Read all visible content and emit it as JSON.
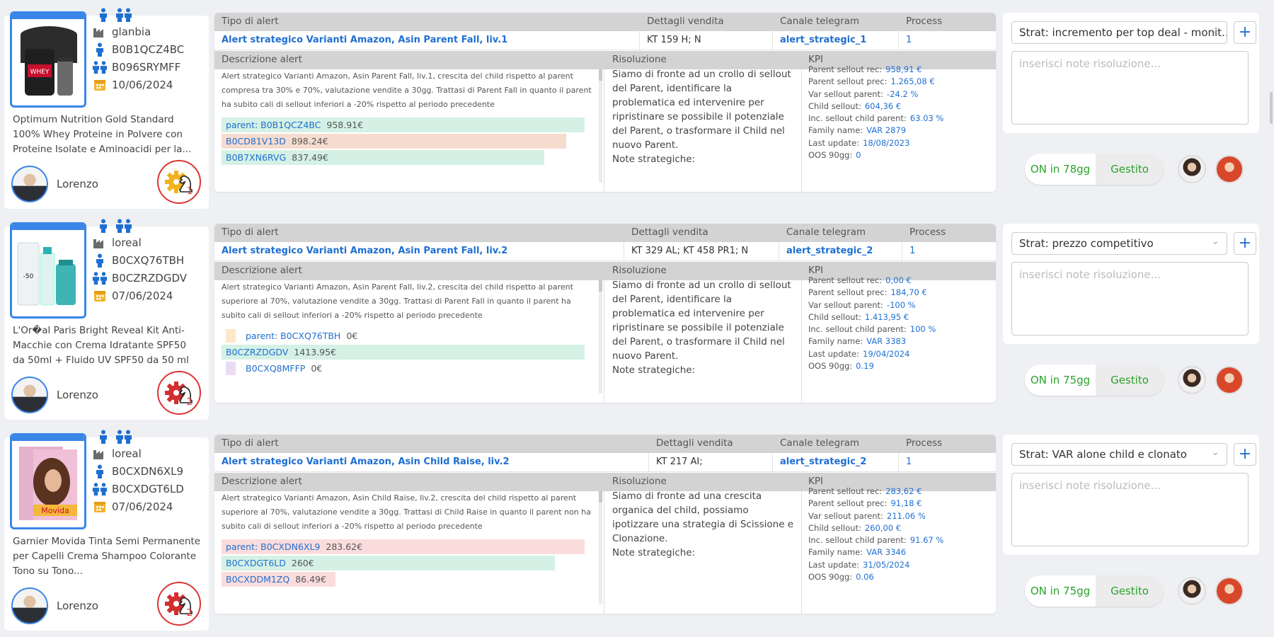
{
  "rows": [
    {
      "brand": "glanbia",
      "asin_child": "B0B1QCZ4BC",
      "asin_parent": "B096SRYMFF",
      "date": "10/06/2024",
      "description": "Optimum Nutrition Gold Standard 100% Whey Proteine in Polvere con Proteine Isolate e Aminoacidi per la...",
      "owner": "Lorenzo",
      "badge_number": "1",
      "headers": {
        "tipo": "Tipo di alert",
        "dettagli": "Dettagli vendita",
        "canale": "Canale telegram",
        "process": "Process",
        "descrizione": "Descrizione alert",
        "risoluzione": "Risoluzione",
        "kpi": "KPI"
      },
      "alert_type": "Alert strategico Varianti Amazon, Asin Parent Fall, liv.1",
      "sales_details": "KT 159 H; N",
      "telegram": "alert_strategic_1",
      "process": "1",
      "alert_description": "Alert strategico Varianti Amazon, Asin Parent Fall, liv.1, crescita del child rispetto al parent compresa tra 30% e 70%, valutazione vendite a 30gg. Trattasi di Parent Fall in quanto il parent ha subito cali di sellout inferiori a -20% rispetto al periodo precedente",
      "bars": [
        {
          "asin": "parent: B0B1QCZ4BC",
          "value": "958.91€",
          "color": "#d5f1e6",
          "fill": 0.99
        },
        {
          "asin": "B0CD81V13D",
          "value": "898.24€",
          "color": "#f6dccf",
          "fill": 0.94
        },
        {
          "asin": "B0B7XN6RVG",
          "value": "837.49€",
          "color": "#d5f1e6",
          "fill": 0.88
        }
      ],
      "resolution": "Siamo di fronte ad un crollo di sellout del Parent, identificare la problematica ed intervenire per ripristinare se possibile il potenziale del Parent, o trasformare il Child nel nuovo Parent.",
      "strategic_notes": "Note strategiche:",
      "kpi": [
        {
          "label": "Parent sellout rec:",
          "value": "958,91 €"
        },
        {
          "label": "Parent sellout prec:",
          "value": "1.265,08 €"
        },
        {
          "label": "Var sellout parent:",
          "value": "-24.2 %"
        },
        {
          "label": "Child sellout:",
          "value": "604,36 €"
        },
        {
          "label": "Inc. sellout child parent:",
          "value": "63.03 %"
        },
        {
          "label": "Family name:",
          "value": "VAR 2879"
        },
        {
          "label": "Last update:",
          "value": "18/08/2023"
        },
        {
          "label": "OOS 90gg:",
          "value": "0"
        }
      ],
      "strategy": "Strat: incremento per top deal - monit...",
      "notes_placeholder": "inserisci note risoluzione...",
      "status_on": "ON in 78gg",
      "status_managed": "Gestito"
    },
    {
      "brand": "loreal",
      "asin_child": "B0CXQ76TBH",
      "asin_parent": "B0CZRZDGDV",
      "date": "07/06/2024",
      "description": "L'Or�al Paris Bright Reveal Kit Anti-Macchie con Crema Idratante SPF50 da 50ml + Fluido UV SPF50 da 50 ml ...",
      "owner": "Lorenzo",
      "badge_number": "2",
      "headers": {
        "tipo": "Tipo di alert",
        "dettagli": "Dettagli vendita",
        "canale": "Canale telegram",
        "process": "Process",
        "descrizione": "Descrizione alert",
        "risoluzione": "Risoluzione",
        "kpi": "KPI"
      },
      "alert_type": "Alert strategico Varianti Amazon, Asin Parent Fall, liv.2",
      "sales_details": "KT 329 AL; KT 458 PR1; N",
      "telegram": "alert_strategic_2",
      "process": "1",
      "alert_description": "Alert strategico Varianti Amazon, Asin Parent Fall, liv.2, crescita del child rispetto al parent superiore al 70%, valutazione vendite a 30gg. Trattasi di Parent Fall in quanto il parent ha subito cali di sellout inferiori a -20% rispetto al periodo precedente",
      "bars": [
        {
          "asin": "parent: B0CXQ76TBH",
          "value": "0€",
          "color": "#fbe9c9",
          "fill": 0
        },
        {
          "asin": "B0CZRZDGDV",
          "value": "1413.95€",
          "color": "#d5f1e6",
          "fill": 0.99
        },
        {
          "asin": "B0CXQ8MFFP",
          "value": "0€",
          "color": "#e9dcf3",
          "fill": 0
        }
      ],
      "resolution": "Siamo di fronte ad un crollo di sellout del Parent, identificare la problematica ed intervenire per ripristinare se possibile il potenziale del Parent, o trasformare il Child nel nuovo Parent.",
      "strategic_notes": "Note strategiche:",
      "kpi": [
        {
          "label": "Parent sellout rec:",
          "value": "0,00 €"
        },
        {
          "label": "Parent sellout prec:",
          "value": "184,70 €"
        },
        {
          "label": "Var sellout parent:",
          "value": "-100 %"
        },
        {
          "label": "Child sellout:",
          "value": "1.413,95 €"
        },
        {
          "label": "Inc. sellout child parent:",
          "value": "100 %"
        },
        {
          "label": "Family name:",
          "value": "VAR 3383"
        },
        {
          "label": "Last update:",
          "value": "19/04/2024"
        },
        {
          "label": "OOS 90gg:",
          "value": "0.19"
        }
      ],
      "strategy": "Strat: prezzo competitivo",
      "notes_placeholder": "inserisci note risoluzione...",
      "status_on": "ON in 75gg",
      "status_managed": "Gestito"
    },
    {
      "brand": "loreal",
      "asin_child": "B0CXDN6XL9",
      "asin_parent": "B0CXDGT6LD",
      "date": "07/06/2024",
      "description": "Garnier Movida Tinta Semi Permanente per Capelli Crema Shampoo Colorante Tono su Tono...",
      "owner": "Lorenzo",
      "badge_number": "2",
      "headers": {
        "tipo": "Tipo di alert",
        "dettagli": "Dettagli vendita",
        "canale": "Canale telegram",
        "process": "Process",
        "descrizione": "Descrizione alert",
        "risoluzione": "Risoluzione",
        "kpi": "KPI"
      },
      "alert_type": "Alert strategico Varianti Amazon, Asin Child Raise, liv.2",
      "sales_details": "KT 217 AI;",
      "telegram": "alert_strategic_2",
      "process": "1",
      "alert_description": "Alert strategico Varianti Amazon, Asin Child Raise, liv.2, crescita del child rispetto al parent superiore al 70%, valutazione vendite a 30gg. Trattasi di Child Raise in quanto il parent non ha subito cali di sellout inferiori a -20% rispetto al periodo precedente",
      "bars": [
        {
          "asin": "parent: B0CXDN6XL9",
          "value": "283.62€",
          "color": "#fbdcdc",
          "fill": 0.99
        },
        {
          "asin": "B0CXDGT6LD",
          "value": "260€",
          "color": "#d5f1e6",
          "fill": 0.91
        },
        {
          "asin": "B0CXDDM1ZQ",
          "value": "86.49€",
          "color": "#fbdcdc",
          "fill": 0.31
        }
      ],
      "resolution": "Siamo di fronte ad una crescita organica del child, possiamo ipotizzare una strategia di Scissione e Clonazione.",
      "strategic_notes": "Note strategiche:",
      "kpi": [
        {
          "label": "Parent sellout rec:",
          "value": "283,62 €"
        },
        {
          "label": "Parent sellout prec:",
          "value": "91,18 €"
        },
        {
          "label": "Var sellout parent:",
          "value": "211.06 %"
        },
        {
          "label": "Child sellout:",
          "value": "260,00 €"
        },
        {
          "label": "Inc. sellout child parent:",
          "value": "91.67 %"
        },
        {
          "label": "Family name:",
          "value": "VAR 3346"
        },
        {
          "label": "Last update:",
          "value": "31/05/2024"
        },
        {
          "label": "OOS 90gg:",
          "value": "0.06"
        }
      ],
      "strategy": "Strat: VAR alone child e clonato",
      "notes_placeholder": "inserisci note risoluzione...",
      "status_on": "ON in 75gg",
      "status_managed": "Gestito"
    }
  ]
}
